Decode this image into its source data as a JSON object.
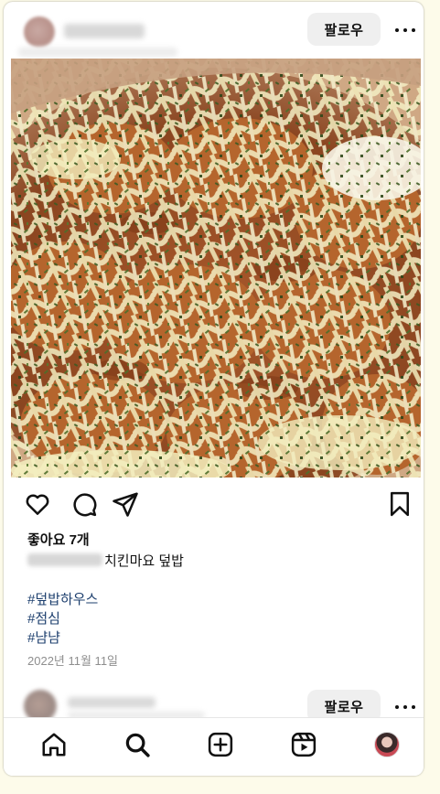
{
  "post": {
    "follow_label": "팔로우",
    "likes_text": "좋아요 7개",
    "caption_text": "치킨마요 덮밥",
    "hashtags": [
      "#덮밥하우스",
      "#점심",
      "#냠냠"
    ],
    "date": "2022년 11월 11일",
    "photo_icon": "chicken-mayo-food-photo"
  },
  "next_post": {
    "follow_label": "팔로우"
  },
  "icons": {
    "more": "more-horizontal-icon",
    "like": "heart-icon",
    "comment": "comment-icon",
    "share": "send-icon",
    "save": "bookmark-icon"
  },
  "nav": {
    "items": [
      "home-icon",
      "search-icon",
      "new-post-icon",
      "reels-icon",
      "profile-avatar"
    ]
  },
  "colors": {
    "hashtag": "#1d3f6e",
    "date": "#8e8e8e",
    "background": "#fdfbea"
  }
}
